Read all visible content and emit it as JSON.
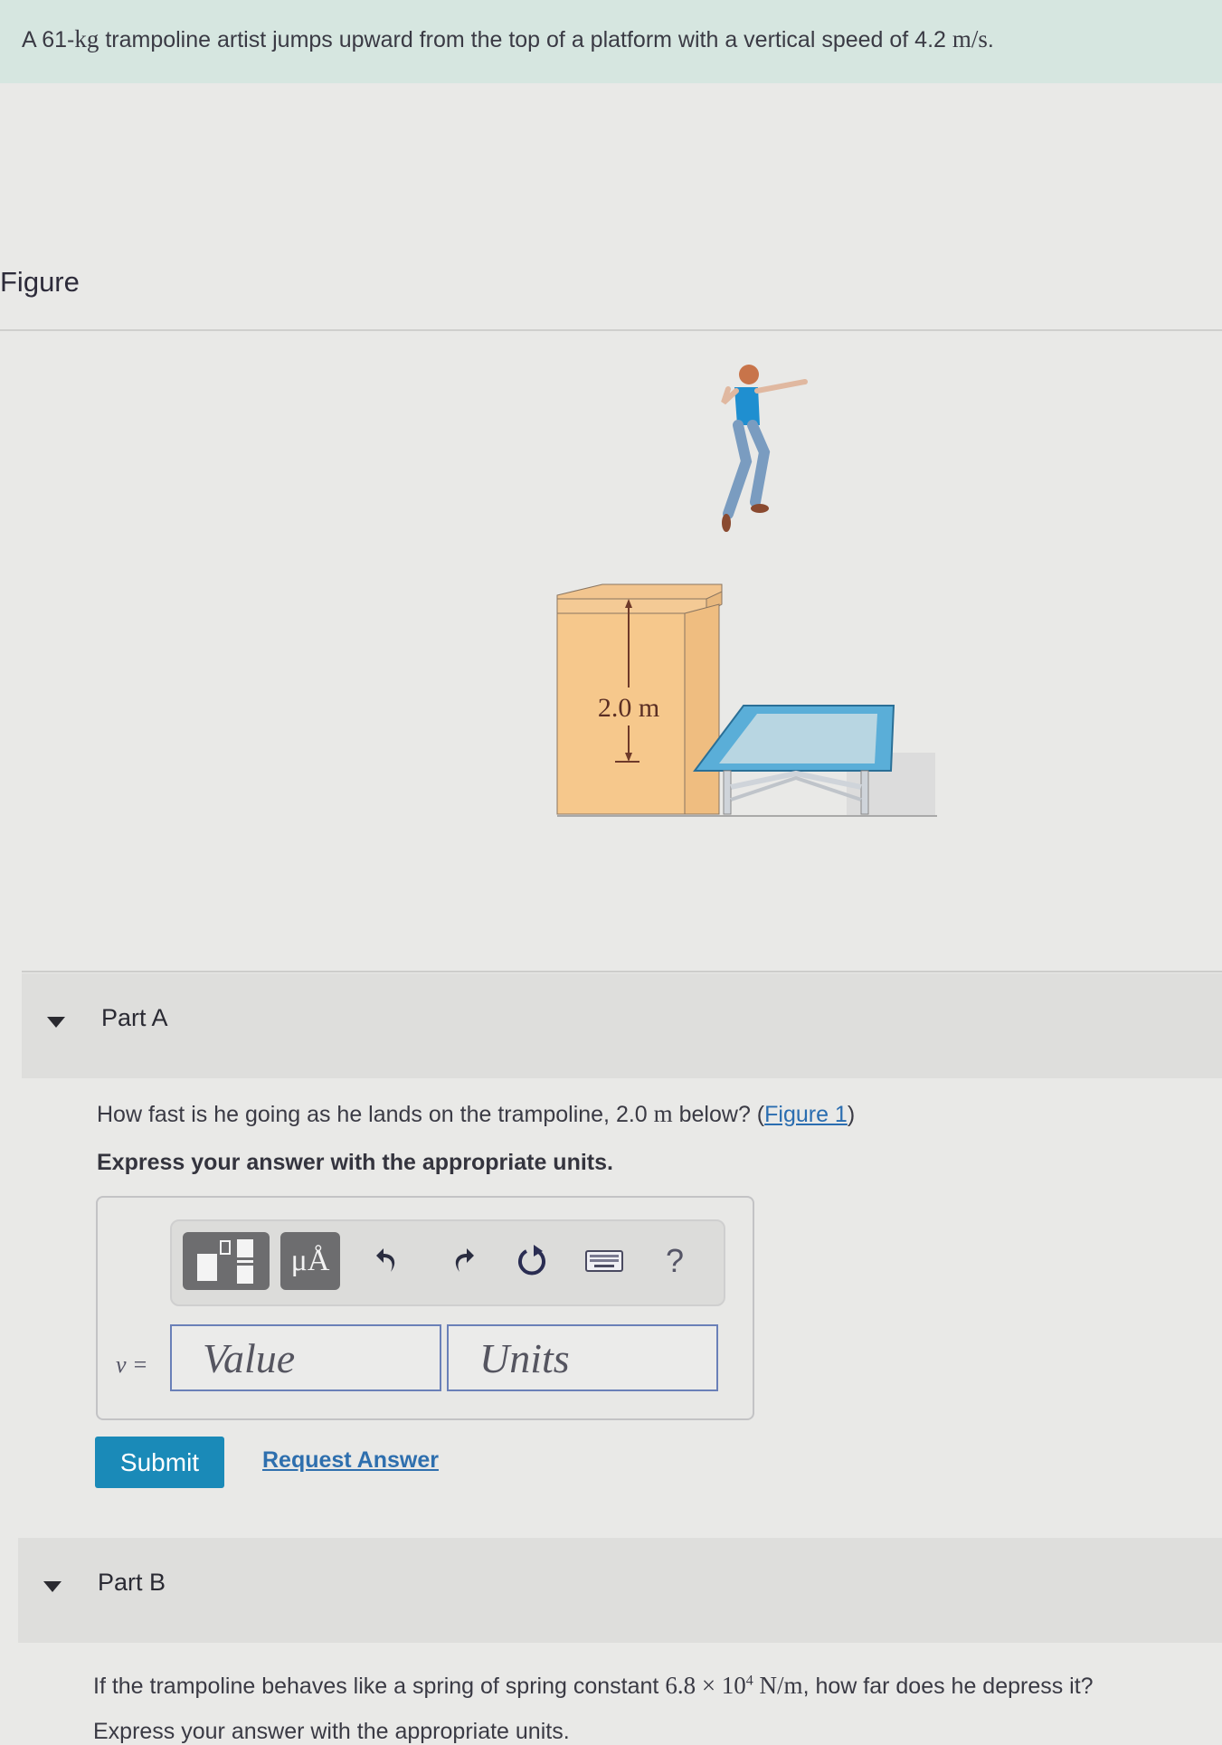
{
  "problem": {
    "intro_prefix": "A 61-",
    "intro_mass_unit": "kg",
    "intro_middle": " trampoline artist jumps upward from the top of a platform with a vertical speed of 4.2 ",
    "intro_speed_unit": "m/s",
    "intro_suffix": "."
  },
  "figure": {
    "heading": "Figure",
    "height_label": "2.0 m",
    "icons": [
      "person-jumping",
      "platform-box",
      "trampoline"
    ]
  },
  "part_a": {
    "title": "Part A",
    "question_prefix": "How fast is he going as he lands on the trampoline, 2.0 ",
    "question_unit": "m",
    "question_middle": " below? (",
    "figure_link": "Figure 1",
    "question_suffix": ")",
    "instruction": "Express your answer with the appropriate units.",
    "toolbar": {
      "templates_icon": "templates-icon",
      "units_label": "μÅ",
      "undo_icon": "undo-icon",
      "redo_icon": "redo-icon",
      "reset_icon": "reset-icon",
      "keyboard_icon": "keyboard-icon",
      "help_label": "?"
    },
    "variable_label": "v =",
    "value_placeholder": "Value",
    "units_placeholder": "Units",
    "submit_label": "Submit",
    "request_answer_label": "Request Answer"
  },
  "part_b": {
    "title": "Part B",
    "question_prefix": "If the trampoline behaves like a spring of spring constant ",
    "question_constant": "6.8 × 10",
    "question_exponent": "4",
    "question_unit": " N/m",
    "question_suffix": ", how far does he depress it?",
    "cut_off_text": "Express your answer with the appropriate units."
  },
  "colors": {
    "banner": "#d6e6e0",
    "submit": "#1a8ab8",
    "link": "#2e6fae",
    "field_border": "#6a80b8"
  }
}
